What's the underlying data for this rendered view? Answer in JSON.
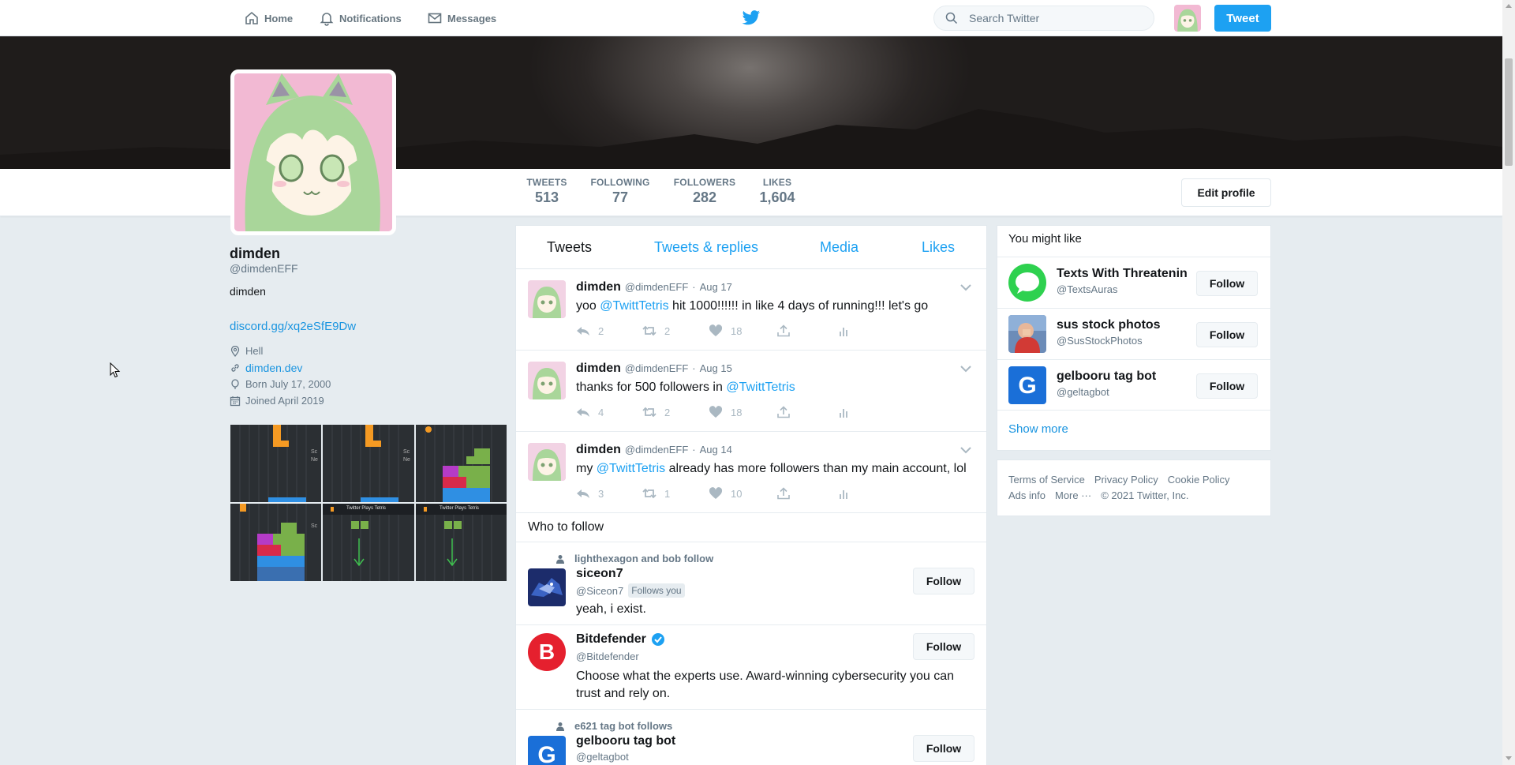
{
  "nav": {
    "home": "Home",
    "notifications": "Notifications",
    "messages": "Messages",
    "search_placeholder": "Search Twitter",
    "tweet_button": "Tweet"
  },
  "stats": [
    {
      "label": "TWEETS",
      "value": "513"
    },
    {
      "label": "FOLLOWING",
      "value": "77"
    },
    {
      "label": "FOLLOWERS",
      "value": "282"
    },
    {
      "label": "LIKES",
      "value": "1,604"
    }
  ],
  "edit_profile": "Edit profile",
  "profile": {
    "name": "dimden",
    "handle": "@dimdenEFF",
    "bio": "dimden",
    "bio_link": "discord.gg/xq2eSfE9Dw",
    "location": "Hell",
    "website": "dimden.dev",
    "born": "Born July 17, 2000",
    "joined": "Joined April 2019"
  },
  "tabs": [
    "Tweets",
    "Tweets & replies",
    "Media",
    "Likes"
  ],
  "tweets": [
    {
      "name": "dimden",
      "handle": "@dimdenEFF",
      "sep": "·",
      "date": "Aug 17",
      "text_before": "yoo ",
      "mention": "@TwittTetris",
      "text_after": " hit 1000!!!!!! in like 4 days of running!!! let's go",
      "replies": "2",
      "retweets": "2",
      "likes": "18"
    },
    {
      "name": "dimden",
      "handle": "@dimdenEFF",
      "sep": "·",
      "date": "Aug 15",
      "text_before": "thanks for 500 followers in ",
      "mention": "@TwittTetris",
      "text_after": "",
      "replies": "4",
      "retweets": "2",
      "likes": "18"
    },
    {
      "name": "dimden",
      "handle": "@dimdenEFF",
      "sep": "·",
      "date": "Aug 14",
      "text_before": "my ",
      "mention": "@TwittTetris",
      "text_after": " already has more followers than my main account, lol",
      "replies": "3",
      "retweets": "1",
      "likes": "10"
    }
  ],
  "who_to_follow": {
    "title": "Who to follow",
    "items": [
      {
        "context": "lighthexagon and bob follow",
        "name": "siceon7",
        "handle": "@Siceon7",
        "follows_you": "Follows you",
        "desc": "yeah, i exist.",
        "button": "Follow"
      },
      {
        "name": "Bitdefender",
        "handle": "@Bitdefender",
        "desc": "Choose what the experts use. Award-winning cybersecurity you can trust and rely on.",
        "button": "Follow"
      },
      {
        "context": "e621 tag bot follows",
        "name": "gelbooru tag bot",
        "handle": "@geltagbot",
        "button": "Follow"
      }
    ]
  },
  "you_might_like": {
    "title": "You might like",
    "items": [
      {
        "name": "Texts With Threatenin",
        "handle": "@TextsAuras",
        "button": "Follow"
      },
      {
        "name": "sus stock photos",
        "handle": "@SusStockPhotos",
        "button": "Follow"
      },
      {
        "name": "gelbooru tag bot",
        "handle": "@geltagbot",
        "button": "Follow"
      }
    ],
    "show_more": "Show more"
  },
  "footer": {
    "terms": "Terms of Service",
    "privacy": "Privacy Policy",
    "cookie": "Cookie Policy",
    "ads": "Ads info",
    "more": "More ···",
    "copyright": "© 2021 Twitter, Inc."
  },
  "colors": {
    "accent": "#1da1f2",
    "link": "#1b95e0",
    "background": "#e6ecf0"
  }
}
